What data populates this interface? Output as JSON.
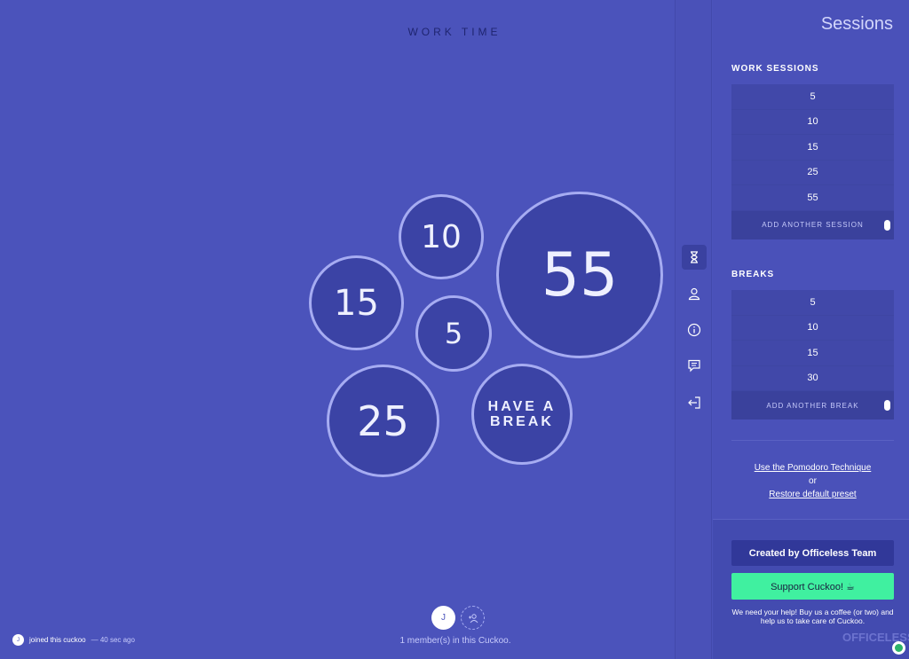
{
  "main": {
    "mode_title": "WORK TIME",
    "bubbles": {
      "b10": "10",
      "b55": "55",
      "b15": "15",
      "b5": "5",
      "b25": "25",
      "break_line1": "HAVE A",
      "break_line2": "BREAK"
    },
    "members": {
      "avatar_initial": "J",
      "count_text": "1 member(s) in this Cuckoo."
    },
    "activity": {
      "avatar_initial": "J",
      "message": "joined this cuckoo",
      "time": "— 40 sec ago"
    }
  },
  "iconbar": {
    "icons": [
      "hourglass-icon",
      "user-icon",
      "info-icon",
      "chat-icon",
      "logout-icon"
    ]
  },
  "sidebar": {
    "title": "Sessions",
    "work_label": "WORK SESSIONS",
    "work_sessions": [
      "5",
      "10",
      "15",
      "25",
      "55"
    ],
    "add_session": "ADD ANOTHER SESSION",
    "breaks_label": "BREAKS",
    "breaks": [
      "5",
      "10",
      "15",
      "30"
    ],
    "add_break": "ADD ANOTHER BREAK",
    "pomodoro_link": "Use the Pomodoro Technique",
    "or_text": "or",
    "restore_link": "Restore default preset",
    "created_by": "Created by Officeless Team",
    "support": "Support Cuckoo! ☕",
    "help_text": "We need your help! Buy us a coffee (or two) and help us to take care of Cuckoo.",
    "brand": "OFFICELESS"
  },
  "colors": {
    "background": "#4b53bb",
    "bubble_fill": "#3b43a5",
    "bubble_border": "#a6acf2",
    "support_green": "#40f0a0",
    "created_btn": "#313899"
  }
}
